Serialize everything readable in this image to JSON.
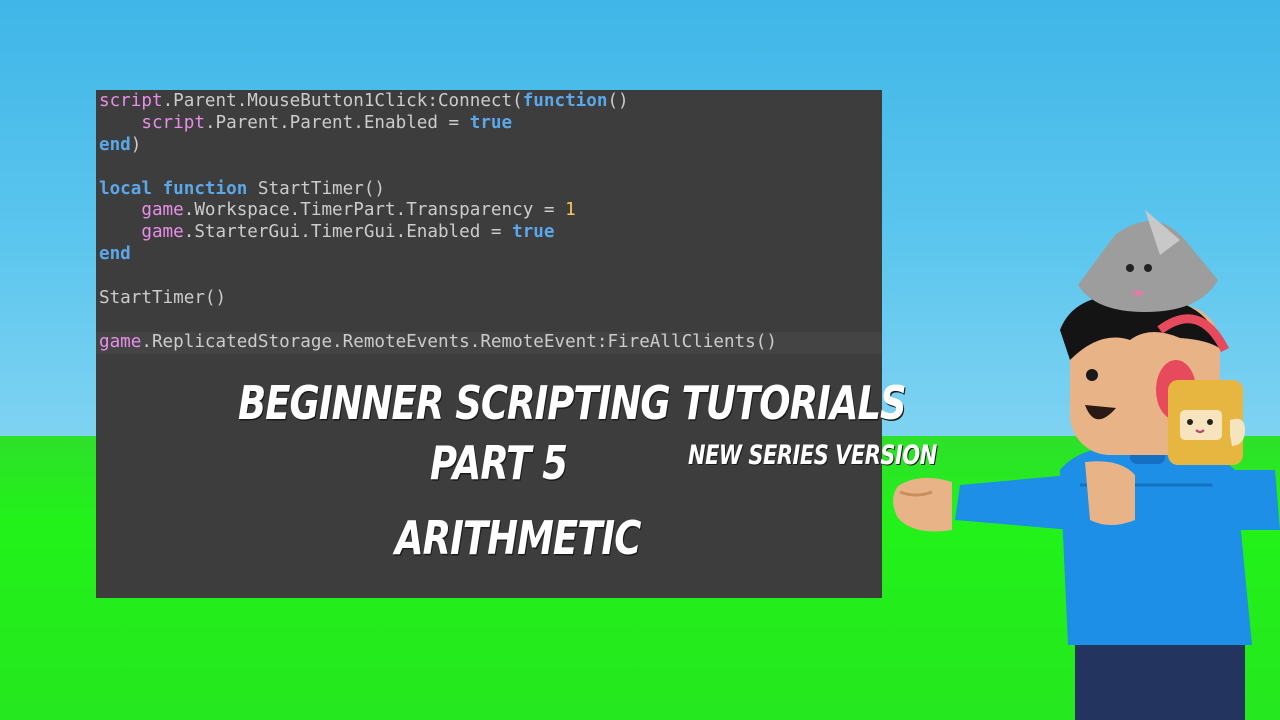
{
  "code_lines": [
    [
      {
        "t": "script",
        "c": "k-pink"
      },
      {
        "t": ".Parent.MouseButton1Click:Connect("
      },
      {
        "t": "function",
        "c": "k-blue"
      },
      {
        "t": "()"
      }
    ],
    [
      {
        "t": "    "
      },
      {
        "t": "script",
        "c": "k-pink"
      },
      {
        "t": ".Parent.Parent.Enabled = "
      },
      {
        "t": "true",
        "c": "k-blue"
      }
    ],
    [
      {
        "t": "end",
        "c": "k-blue"
      },
      {
        "t": ")"
      }
    ],
    [],
    [
      {
        "t": "local",
        "c": "k-blue"
      },
      {
        "t": " "
      },
      {
        "t": "function",
        "c": "k-blue"
      },
      {
        "t": " StartTimer()"
      }
    ],
    [
      {
        "t": "    "
      },
      {
        "t": "game",
        "c": "k-pink"
      },
      {
        "t": ".Workspace.TimerPart.Transparency = "
      },
      {
        "t": "1",
        "c": "k-num"
      }
    ],
    [
      {
        "t": "    "
      },
      {
        "t": "game",
        "c": "k-pink"
      },
      {
        "t": ".StarterGui.TimerGui.Enabled = "
      },
      {
        "t": "true",
        "c": "k-blue"
      }
    ],
    [
      {
        "t": "end",
        "c": "k-blue"
      }
    ],
    [],
    [
      {
        "t": "StartTimer()"
      }
    ],
    [],
    [
      {
        "t": "game",
        "c": "k-pink"
      },
      {
        "t": ".ReplicatedStorage.RemoteEvents.RemoteEvent:FireAllClients()"
      }
    ]
  ],
  "title": {
    "line1": "BEGINNER SCRIPTING TUTORIALS",
    "line2": "PART 5",
    "line3": "ARITHMETIC",
    "tag": "NEW SERIES VERSION"
  },
  "colors": {
    "keyword_pink": "#e88ee9",
    "keyword_blue": "#5aa8ea",
    "number": "#ffc65a",
    "code_text": "#cccccc",
    "panel_bg": "#3d3d3d",
    "sky": "#4cbfeb",
    "ground": "#22f21a"
  },
  "icons": {
    "character": "roblox-avatar-character"
  }
}
